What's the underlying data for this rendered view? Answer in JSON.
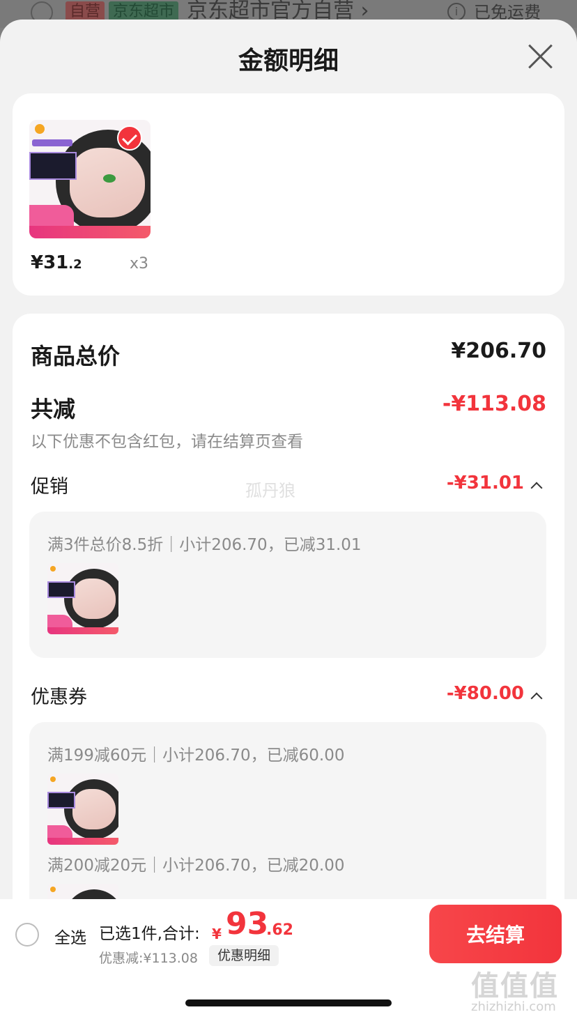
{
  "background_bar": {
    "tag_self": "自营",
    "tag_market": "京东超市",
    "shop_name": "京东超市官方自营 ›",
    "info_icon": "i",
    "shipping": "已免运费"
  },
  "sheet": {
    "title": "金额明细",
    "close_icon": "close-icon"
  },
  "product": {
    "price_int": "¥31",
    "price_dec": ".2",
    "qty": "x3"
  },
  "summary": {
    "total_label": "商品总价",
    "total_value": "¥206.70",
    "reduce_label": "共减",
    "reduce_value": "-¥113.08",
    "note": "以下优惠不包含红包，请在结算页查看"
  },
  "promotion": {
    "label": "促销",
    "value": "-¥31.01",
    "watermark": "孤丹狼",
    "rule": "满3件总价8.5折｜小计206.70，已减31.01"
  },
  "coupon": {
    "label": "优惠券",
    "value": "-¥80.00",
    "rules": [
      "满199减60元｜小计206.70，已减60.00",
      "满200减20元｜小计206.70，已减20.00"
    ]
  },
  "bottom_bar": {
    "select_all": "全选",
    "selected_info": "已选1件,合计:",
    "total_currency": "¥",
    "total_int": "93",
    "total_dec": ".62",
    "discount_text": "优惠减:¥113.08",
    "discount_detail": "优惠明细",
    "checkout": "去结算"
  },
  "site_watermark": {
    "logo_text": "值值值",
    "url": "zhizhizhi.com"
  },
  "colors": {
    "accent_red": "#f2343c",
    "sheet_bg": "#f2f2f2",
    "card_bg": "#ffffff"
  }
}
